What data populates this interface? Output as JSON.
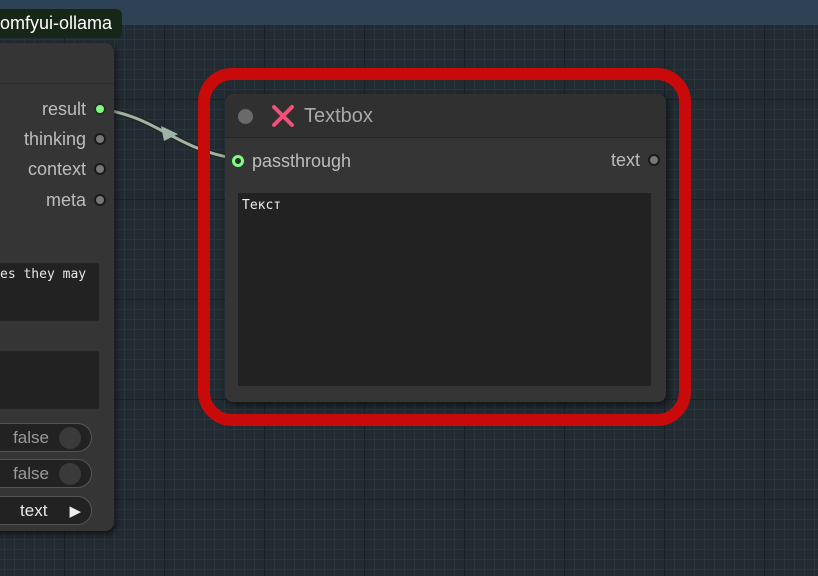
{
  "group_title": "omfyui-ollama",
  "left_node": {
    "outputs": [
      "result",
      "thinking",
      "context",
      "meta"
    ],
    "widgets": {
      "text_preview": "es they may",
      "toggle_1": "false",
      "toggle_2": "false",
      "combo_value": "text"
    }
  },
  "textbox_node": {
    "title": "Textbox",
    "input_label": "passthrough",
    "output_label": "text",
    "text_value": "Текст"
  },
  "colors": {
    "highlight": "#c80a0a",
    "socket_active": "#7dff7d",
    "close_icon": "#f0507a",
    "link": "#9fb3a7"
  }
}
